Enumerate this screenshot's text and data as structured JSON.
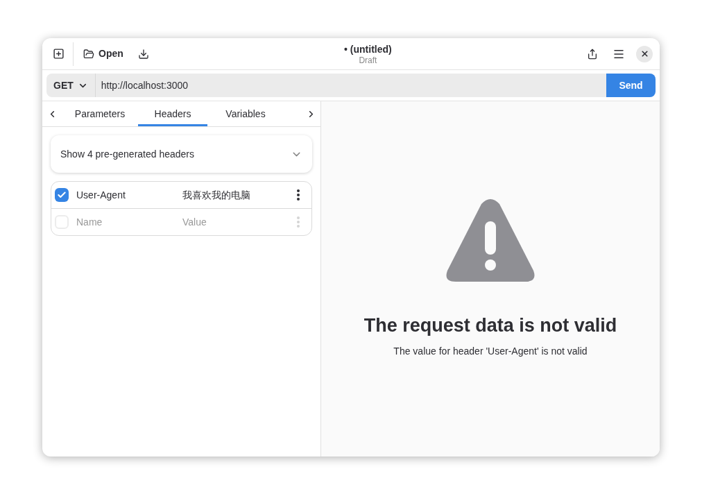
{
  "header_bar": {
    "open_label": "Open",
    "title": "• (untitled)",
    "subtitle": "Draft"
  },
  "request": {
    "method": "GET",
    "url": "http://localhost:3000",
    "send_label": "Send"
  },
  "tabs": [
    {
      "label": "Parameters",
      "selected": false
    },
    {
      "label": "Headers",
      "selected": true
    },
    {
      "label": "Variables",
      "selected": false
    }
  ],
  "pregenerated": {
    "label": "Show 4 pre-generated headers",
    "expanded": false
  },
  "headers": [
    {
      "checked": true,
      "disabled": false,
      "name": "User-Agent",
      "value": "我喜欢我的电脑"
    },
    {
      "checked": false,
      "disabled": true,
      "name_placeholder": "Name",
      "value_placeholder": "Value"
    }
  ],
  "error": {
    "title": "The request data is not valid",
    "message": "The value for header 'User-Agent' is not valid"
  }
}
